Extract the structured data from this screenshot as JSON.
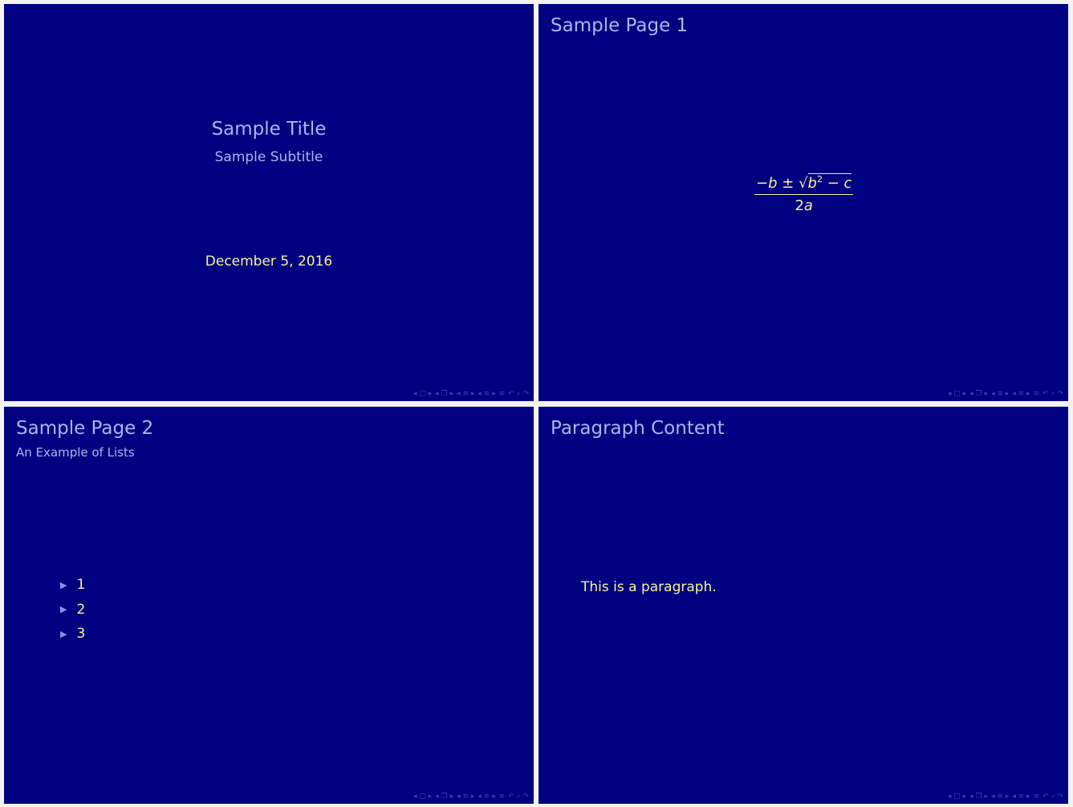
{
  "colors": {
    "background": "#000080",
    "title": "#aeb4f0",
    "body_text": "#f7f39a",
    "nav": "#3f4ab8"
  },
  "slides": [
    {
      "title": "Sample Title",
      "subtitle": "Sample Subtitle",
      "date": "December 5, 2016"
    },
    {
      "title": "Sample Page 1",
      "formula": {
        "minus": "−",
        "b": "b",
        "pm": " ± ",
        "sqrt": "√",
        "b2": "b",
        "exp": "2",
        "minus2": " − ",
        "c": "c",
        "den_num": "2",
        "den_var": "a"
      }
    },
    {
      "title": "Sample Page 2",
      "subtitle": "An Example of Lists",
      "items": [
        "1",
        "2",
        "3"
      ],
      "bullet": "▶"
    },
    {
      "title": "Paragraph Content",
      "paragraph": "This is a paragraph."
    }
  ],
  "nav_icons": [
    "◂ □ ▸",
    "◂ ❐ ▸",
    "◂ ≡ ▸",
    "◂ ≡ ▸",
    "≡",
    "↶ ⌕ ↷"
  ]
}
